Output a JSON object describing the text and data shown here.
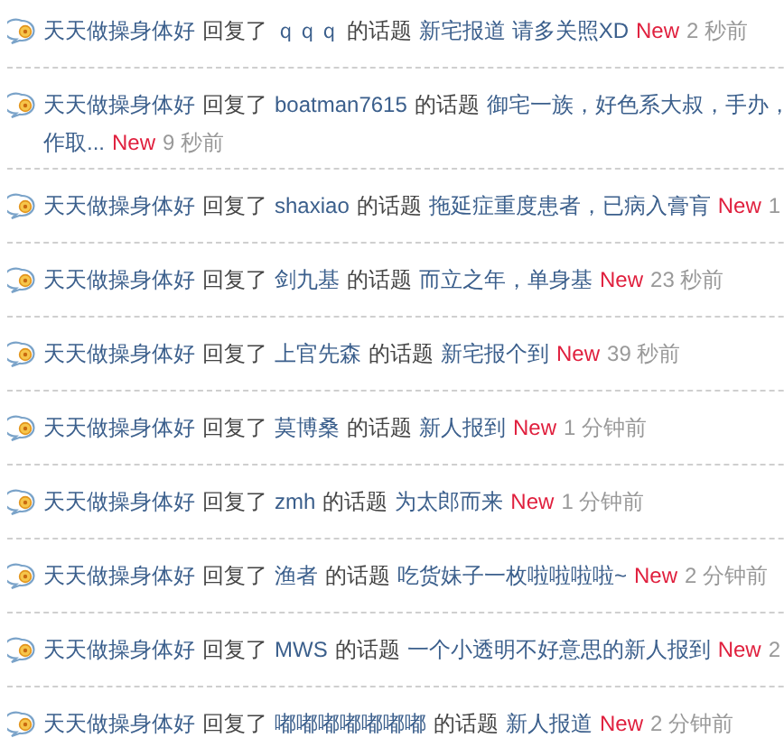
{
  "feed": [
    {
      "user": "天天做操身体好",
      "action": "回复了",
      "target": "ｑｑｑ",
      "of": "的话题",
      "topic": "新宅报道 请多关照XD",
      "badge": "New",
      "time": "2 秒前"
    },
    {
      "user": "天天做操身体好",
      "action": "回复了",
      "target": "boatman7615",
      "of": "的话题",
      "topic": "御宅一族，好色系大叔，手办，",
      "topic_more": "作取...",
      "badge": "New",
      "time": "9 秒前"
    },
    {
      "user": "天天做操身体好",
      "action": "回复了",
      "target": "shaxiao",
      "of": "的话题",
      "topic": "拖延症重度患者，已病入膏肓",
      "badge": "New",
      "time": "1"
    },
    {
      "user": "天天做操身体好",
      "action": "回复了",
      "target": "剑九基",
      "of": "的话题",
      "topic": "而立之年，单身基",
      "badge": "New",
      "time": "23 秒前"
    },
    {
      "user": "天天做操身体好",
      "action": "回复了",
      "target": "上官先森",
      "of": "的话题",
      "topic": "新宅报个到",
      "badge": "New",
      "time": "39 秒前"
    },
    {
      "user": "天天做操身体好",
      "action": "回复了",
      "target": "莫博桑",
      "of": "的话题",
      "topic": "新人报到",
      "badge": "New",
      "time": "1 分钟前"
    },
    {
      "user": "天天做操身体好",
      "action": "回复了",
      "target": "zmh",
      "of": "的话题",
      "topic": "为太郎而来",
      "badge": "New",
      "time": "1 分钟前"
    },
    {
      "user": "天天做操身体好",
      "action": "回复了",
      "target": "渔者",
      "of": "的话题",
      "topic": "吃货妹子一枚啦啦啦啦~",
      "badge": "New",
      "time": "2 分钟前"
    },
    {
      "user": "天天做操身体好",
      "action": "回复了",
      "target": "MWS",
      "of": "的话题",
      "topic": "一个小透明不好意思的新人报到",
      "badge": "New",
      "time": "2"
    },
    {
      "user": "天天做操身体好",
      "action": "回复了",
      "target": "嘟嘟嘟嘟嘟嘟嘟",
      "of": "的话题",
      "topic": "新人报道",
      "badge": "New",
      "time": "2 分钟前"
    }
  ]
}
